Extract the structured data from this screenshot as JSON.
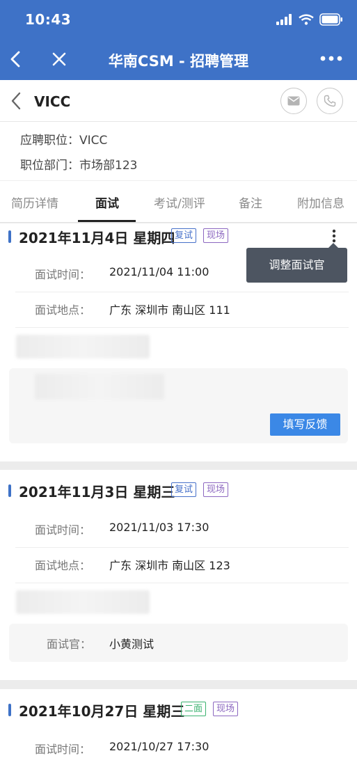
{
  "status": {
    "time": "10:43"
  },
  "nav": {
    "title": "华南CSM - 招聘管理"
  },
  "candidate": {
    "name": "VICC"
  },
  "info": {
    "position_label": "应聘职位：",
    "position_value": "VICC",
    "dept_label": "职位部门：",
    "dept_value": "市场部123"
  },
  "tabs": [
    {
      "label": "简历详情",
      "active": false
    },
    {
      "label": "面试",
      "active": true
    },
    {
      "label": "考试/测评",
      "active": false
    },
    {
      "label": "备注",
      "active": false
    },
    {
      "label": "附加信息",
      "active": false
    }
  ],
  "popover": {
    "label": "调整面试官"
  },
  "interviews": [
    {
      "date": "2021年11月4日 星期四",
      "tags": [
        "复试",
        "现场"
      ],
      "time_label": "面试时间：",
      "time_value": "2021/11/04 11:00",
      "place_label": "面试地点：",
      "place_value": "广东 深圳市 南山区 111",
      "feedback_button": "填写反馈"
    },
    {
      "date": "2021年11月3日 星期三",
      "tags": [
        "复试",
        "现场"
      ],
      "time_label": "面试时间：",
      "time_value": "2021/11/03 17:30",
      "place_label": "面试地点：",
      "place_value": "广东 深圳市 南山区 123",
      "interviewer_label": "面试官：",
      "interviewer_value": "小黄测试"
    },
    {
      "date": "2021年10月27日 星期三",
      "tags": [
        "二面",
        "现场"
      ],
      "time_label": "面试时间：",
      "time_value": "2021/10/27 17:30"
    }
  ],
  "colors": {
    "nav": "#3e72c7",
    "accent": "#3b88e6",
    "tag_blue": "#4670c9",
    "tag_purple": "#8c67c0",
    "tag_green": "#3bb26f"
  },
  "icons": [
    "back-icon",
    "close-icon",
    "more-icon",
    "mail-icon",
    "phone-icon",
    "kebab-icon",
    "signal-icon",
    "wifi-icon",
    "battery-icon"
  ]
}
